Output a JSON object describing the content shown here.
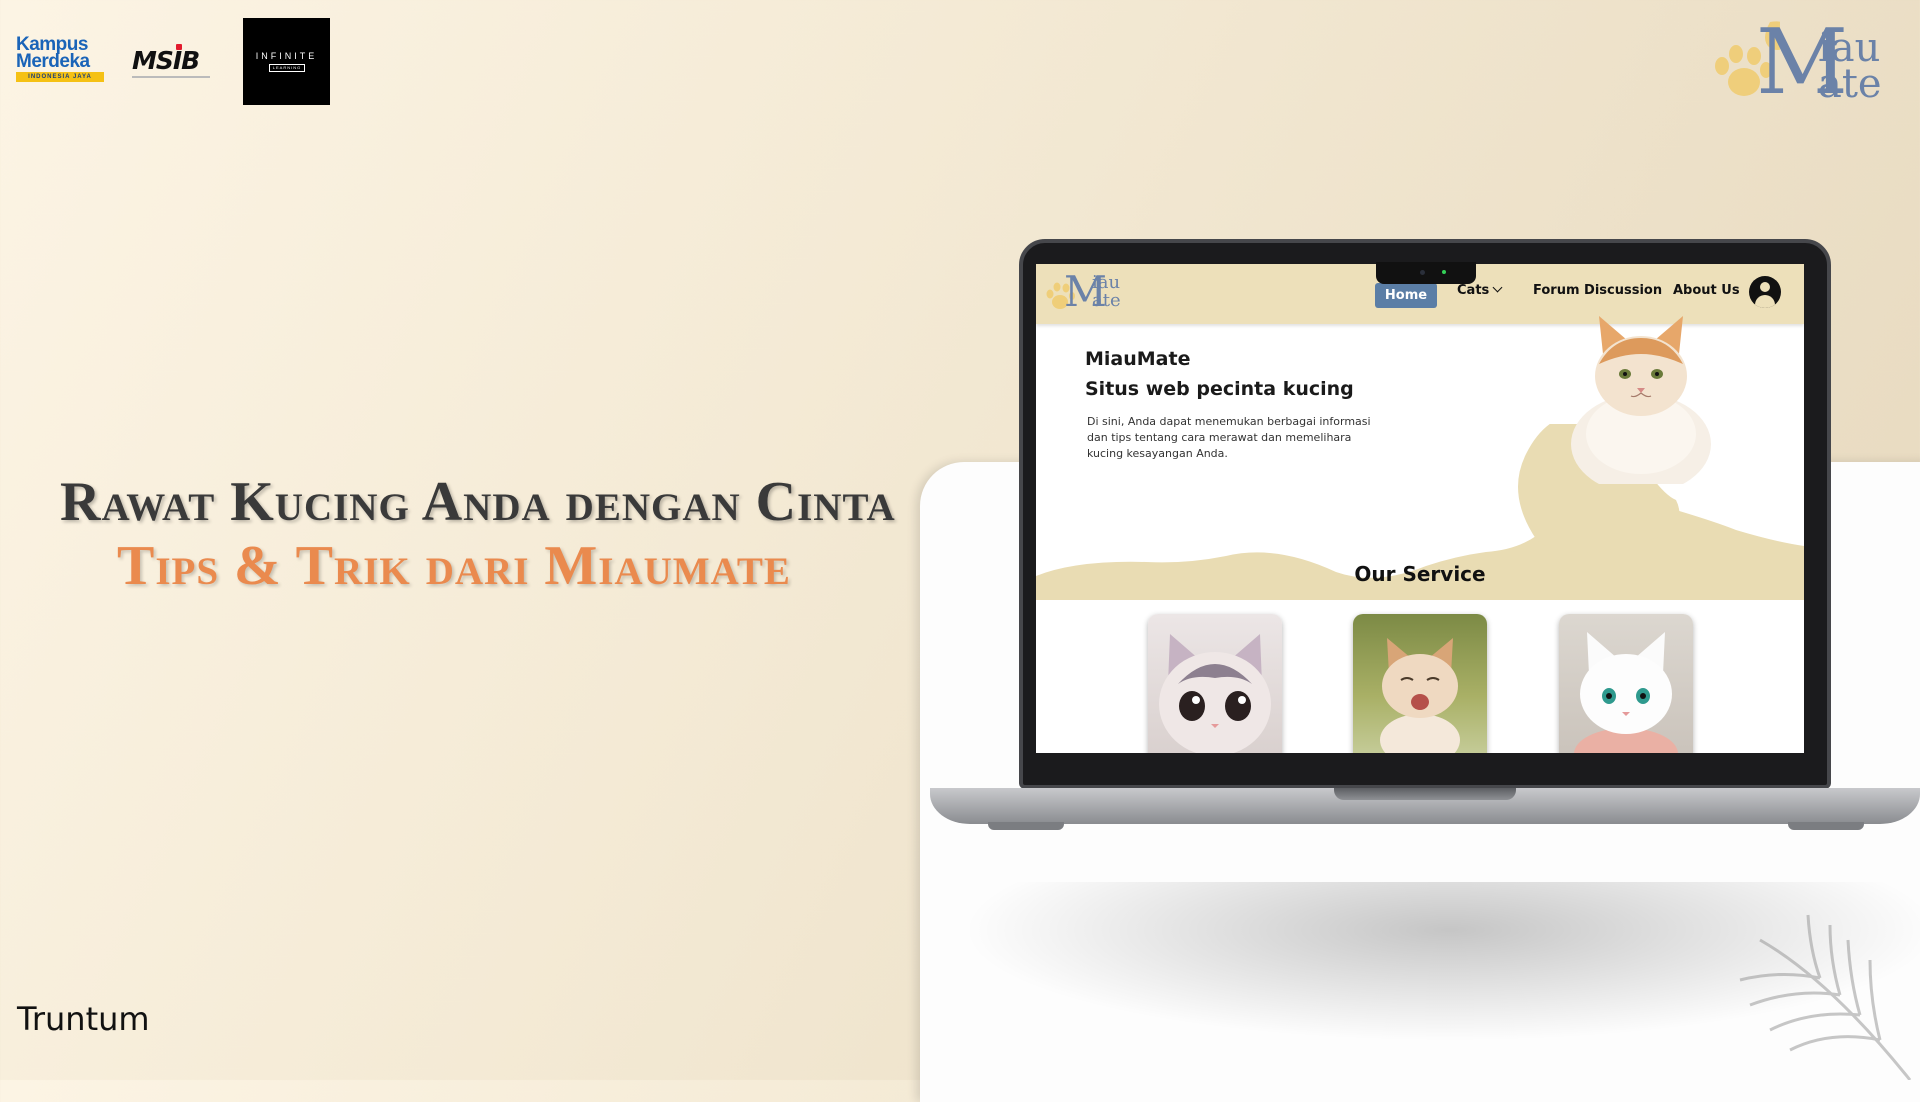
{
  "partners": {
    "kampus_merdeka": {
      "line1": "Kampus",
      "line2": "Merdeka",
      "tagline": "INDONESIA JAYA"
    },
    "msib": {
      "label": "MSIB"
    },
    "infinite_learning": {
      "title": "INFINITE",
      "subtitle": "LEARNING"
    }
  },
  "brand": {
    "letter": "M",
    "line1": "iau",
    "line2": "ate",
    "color": "#6b82a8"
  },
  "headline": {
    "line1": "Rawat Kucing Anda dengan Cinta",
    "line2": "Tips & Trik dari Miaumate",
    "color1": "#3a3a3a",
    "color2": "#ea8a4e"
  },
  "font_caption": "Truntum",
  "website": {
    "logo": {
      "letter": "M",
      "line1": "iau",
      "line2": "ate"
    },
    "nav": {
      "home": "Home",
      "cats": "Cats",
      "forum": "Forum Discussion",
      "about": "About Us"
    },
    "hero": {
      "title": "MiauMate",
      "subtitle": "Situs web pecinta kucing",
      "description": "Di sini, Anda dapat menemukan berbagai informasi dan tips tentang cara merawat dan memelihara kucing kesayangan Anda."
    },
    "service_title": "Our Service",
    "accent_color": "#5b7ea6",
    "nav_bg": "#ede0ba",
    "wave_color": "#e9dcb3"
  },
  "icons": [
    "paw-icon",
    "user-account-icon",
    "chevron-down-icon",
    "cat-photo",
    "palm-leaf-decoration"
  ]
}
